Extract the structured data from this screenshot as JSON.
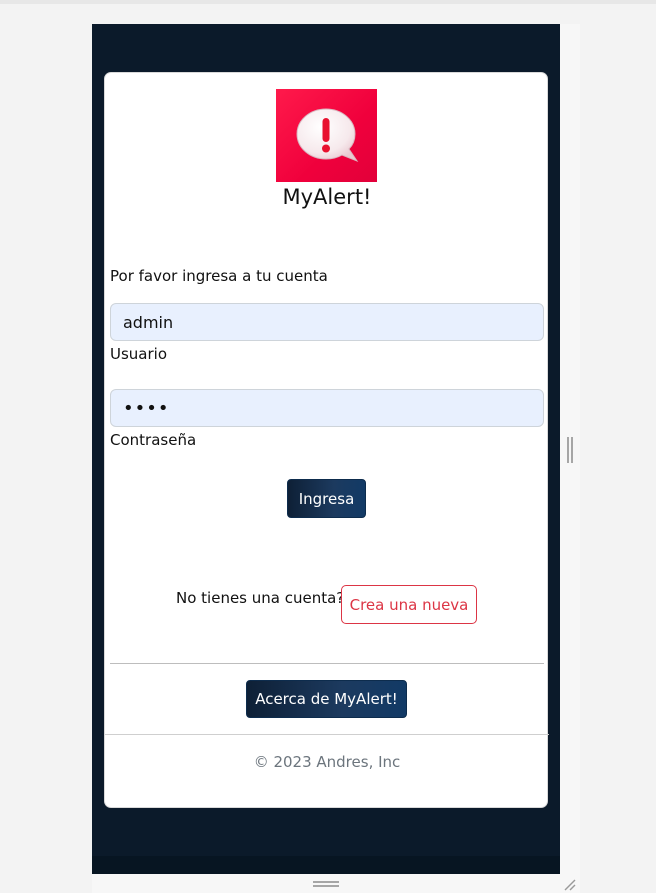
{
  "app": {
    "title": "MyAlert!",
    "prompt": "Por favor ingresa a tu cuenta"
  },
  "login": {
    "username_value": "admin",
    "username_label": "Usuario",
    "password_mask": "••••",
    "password_label": "Contraseña",
    "submit_label": "Ingresa"
  },
  "register": {
    "question": "No tienes una cuenta?",
    "button_label": "Crea una nueva"
  },
  "about": {
    "button_label": "Acerca de MyAlert!"
  },
  "footer": {
    "copyright": "© 2023 Andres, Inc"
  },
  "icons": {
    "logo": "alert-speech-bubble-icon"
  },
  "colors": {
    "brand": "#f0003c",
    "background": "#0b1a2a",
    "primary_button": "#1c3a5f",
    "danger": "#dc3545"
  }
}
